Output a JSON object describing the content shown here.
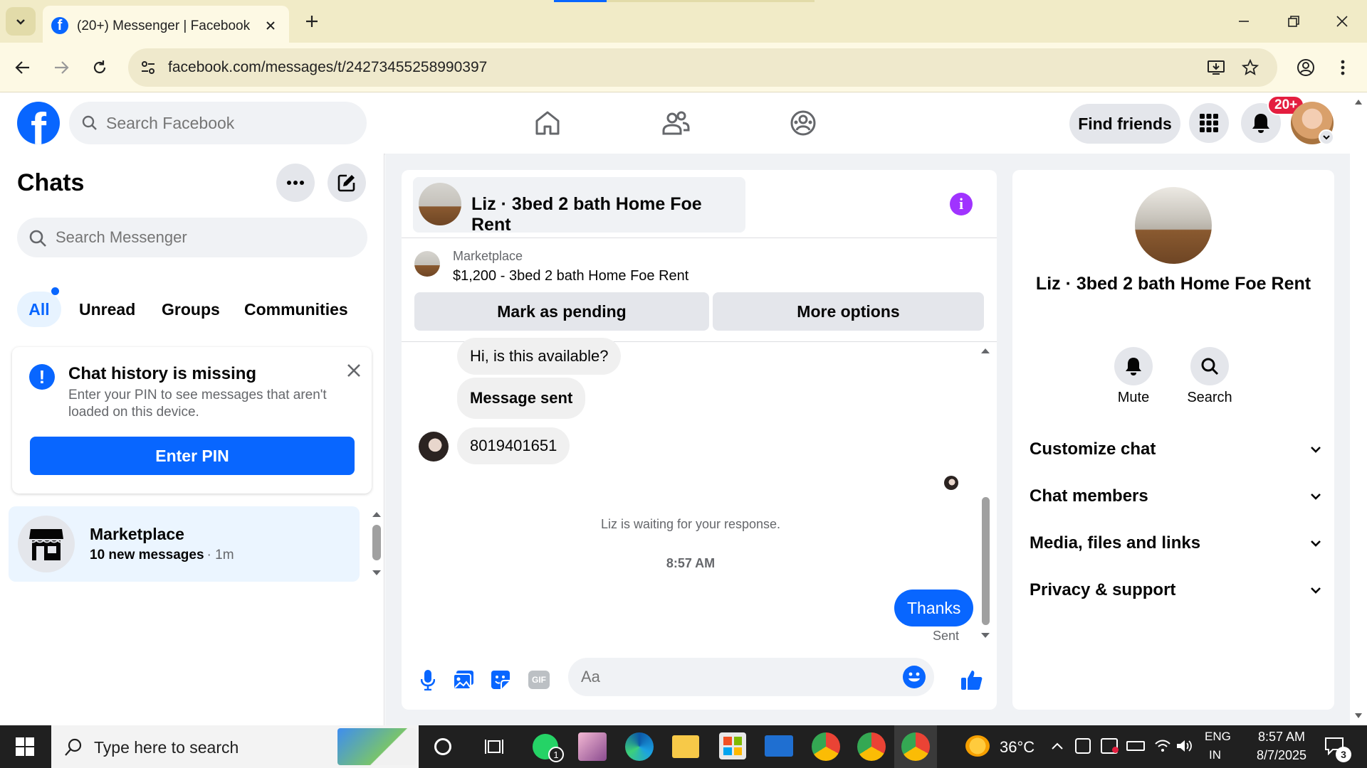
{
  "browser": {
    "tab_title": "(20+) Messenger | Facebook",
    "url": "facebook.com/messages/t/24273455258990397"
  },
  "fb_header": {
    "search_placeholder": "Search Facebook",
    "find_friends_label": "Find friends",
    "notifications_badge": "20+"
  },
  "sidebar": {
    "title": "Chats",
    "search_placeholder": "Search Messenger",
    "filter_tabs": [
      "All",
      "Unread",
      "Groups",
      "Communities"
    ],
    "banner": {
      "title": "Chat history is missing",
      "body": "Enter your PIN to see messages that aren't loaded on this device.",
      "button_label": "Enter PIN"
    },
    "chat_list": [
      {
        "name": "Marketplace",
        "preview": "10 new messages",
        "time": "· 1m"
      }
    ]
  },
  "conversation": {
    "title": "Liz · 3bed 2 bath Home Foe Rent",
    "marketplace_label": "Marketplace",
    "listing": "$1,200 - 3bed 2 bath Home Foe Rent",
    "mark_pending_label": "Mark as pending",
    "more_options_label": "More options",
    "messages": [
      {
        "text": "Hi, is this available?",
        "side": "left",
        "bold": false
      },
      {
        "text": "Message sent",
        "side": "left",
        "bold": true
      },
      {
        "text": "8019401651",
        "side": "left",
        "bold": false
      }
    ],
    "waiting_text": "Liz is waiting for your response.",
    "timestamp": "8:57 AM",
    "outgoing": {
      "text": "Thanks",
      "status": "Sent"
    },
    "composer_placeholder": "Aa"
  },
  "info_panel": {
    "name": "Liz · 3bed 2 bath Home Foe Rent",
    "mute_label": "Mute",
    "search_label": "Search",
    "sections": [
      "Customize chat",
      "Chat members",
      "Media, files and links",
      "Privacy & support"
    ]
  },
  "taskbar": {
    "search_placeholder": "Type here to search",
    "whatsapp_badge": "1",
    "temperature": "36°C",
    "lang_line1": "ENG",
    "lang_line2": "IN",
    "time": "8:57 AM",
    "date": "8/7/2025",
    "notification_count": "3"
  },
  "colors": {
    "fb_blue": "#0866ff",
    "messenger_purple": "#a033ff",
    "badge_red": "#e41e3f",
    "chrome_tabstrip": "#f1ebc7",
    "page_bg": "#f0f2f5"
  }
}
